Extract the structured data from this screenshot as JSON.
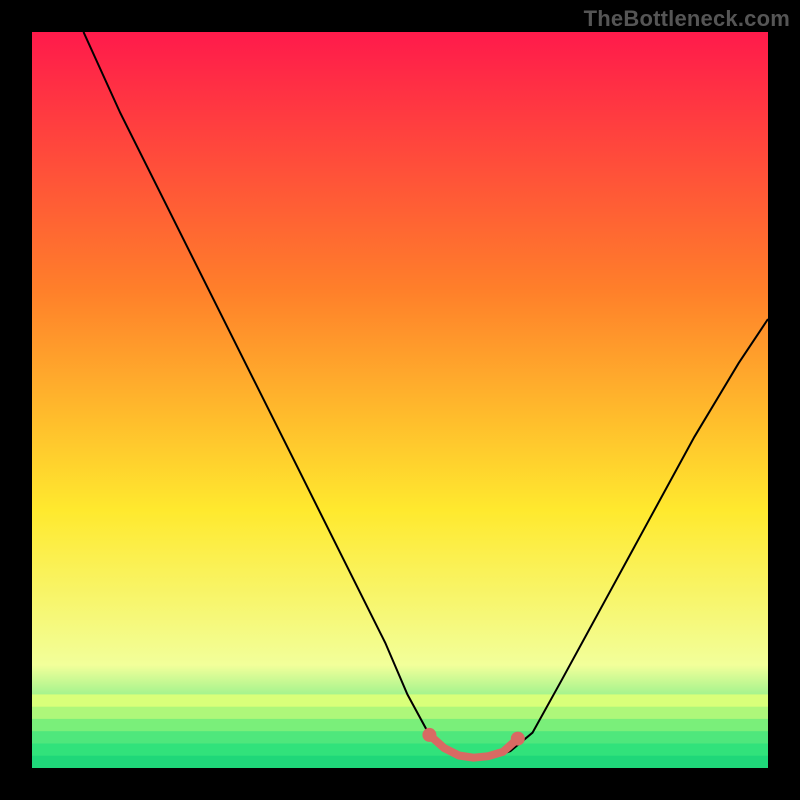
{
  "watermark": "TheBottleneck.com",
  "colors": {
    "gradient_top": "#ff1a4b",
    "gradient_mid1": "#ff7f2a",
    "gradient_mid2": "#ffe92e",
    "gradient_low": "#f2ff9a",
    "gradient_green": "#31e27b",
    "curve": "#000000",
    "highlight": "#d86a63",
    "frame": "#000000"
  },
  "chart_data": {
    "type": "line",
    "title": "",
    "xlabel": "",
    "ylabel": "",
    "xlim": [
      0,
      100
    ],
    "ylim": [
      0,
      100
    ],
    "series": [
      {
        "name": "bottleneck-curve",
        "x": [
          7,
          12,
          18,
          24,
          30,
          36,
          42,
          48,
          51,
          54,
          57,
          60,
          63,
          65,
          68,
          72,
          78,
          84,
          90,
          96,
          100
        ],
        "y": [
          100,
          89,
          77,
          65,
          53,
          41,
          29,
          17,
          10,
          4.5,
          2.2,
          1.4,
          1.6,
          2.3,
          4.8,
          12,
          23,
          34,
          45,
          55,
          61
        ]
      },
      {
        "name": "minimum-highlight",
        "x": [
          54,
          56,
          58,
          60,
          62,
          64,
          66
        ],
        "y": [
          4.5,
          2.7,
          1.7,
          1.4,
          1.6,
          2.2,
          4.0
        ]
      }
    ],
    "annotations": []
  }
}
